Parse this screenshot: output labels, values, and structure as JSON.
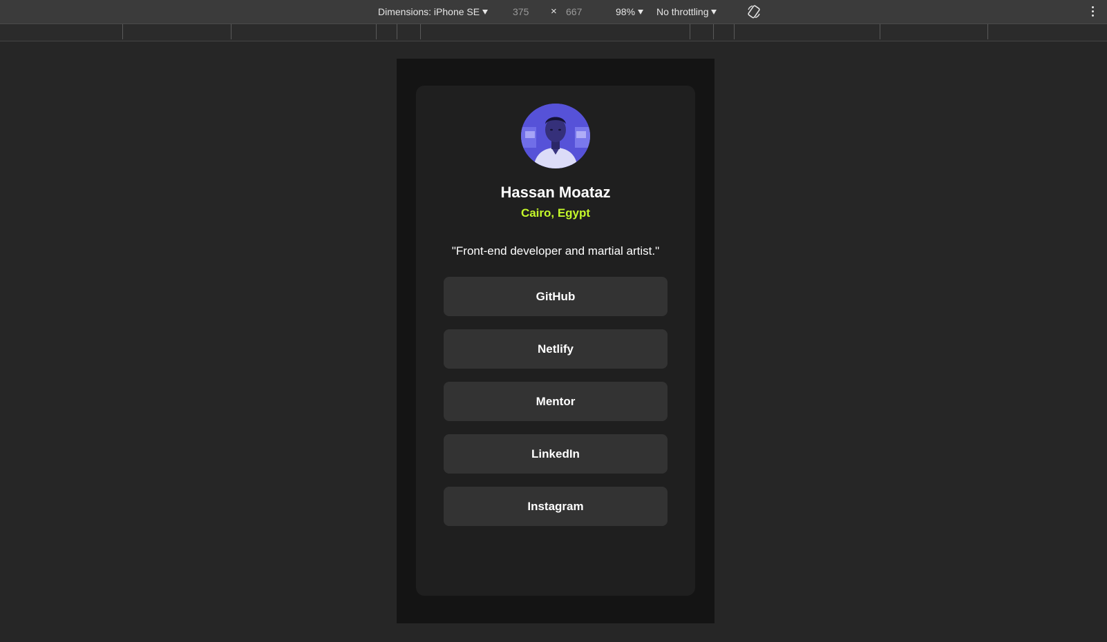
{
  "devtools": {
    "dimensions_label": "Dimensions: iPhone SE",
    "width": "375",
    "times": "×",
    "height": "667",
    "zoom": "98%",
    "throttling": "No throttling",
    "icons": {
      "rotate": "rotate-icon",
      "more": "more-vert-icon"
    }
  },
  "profile": {
    "avatar_icon": "avatar-photo",
    "name": "Hassan Moataz",
    "location": "Cairo, Egypt",
    "bio": "\"Front-end developer and martial artist.\"",
    "links": [
      {
        "label": "GitHub"
      },
      {
        "label": "Netlify"
      },
      {
        "label": "Mentor"
      },
      {
        "label": "LinkedIn"
      },
      {
        "label": "Instagram"
      }
    ]
  },
  "colors": {
    "page_bg": "#262626",
    "card_bg": "#1f1f1f",
    "button_bg": "#333333",
    "accent": "#c4f82a",
    "avatar_tint": "#5b56d6"
  }
}
